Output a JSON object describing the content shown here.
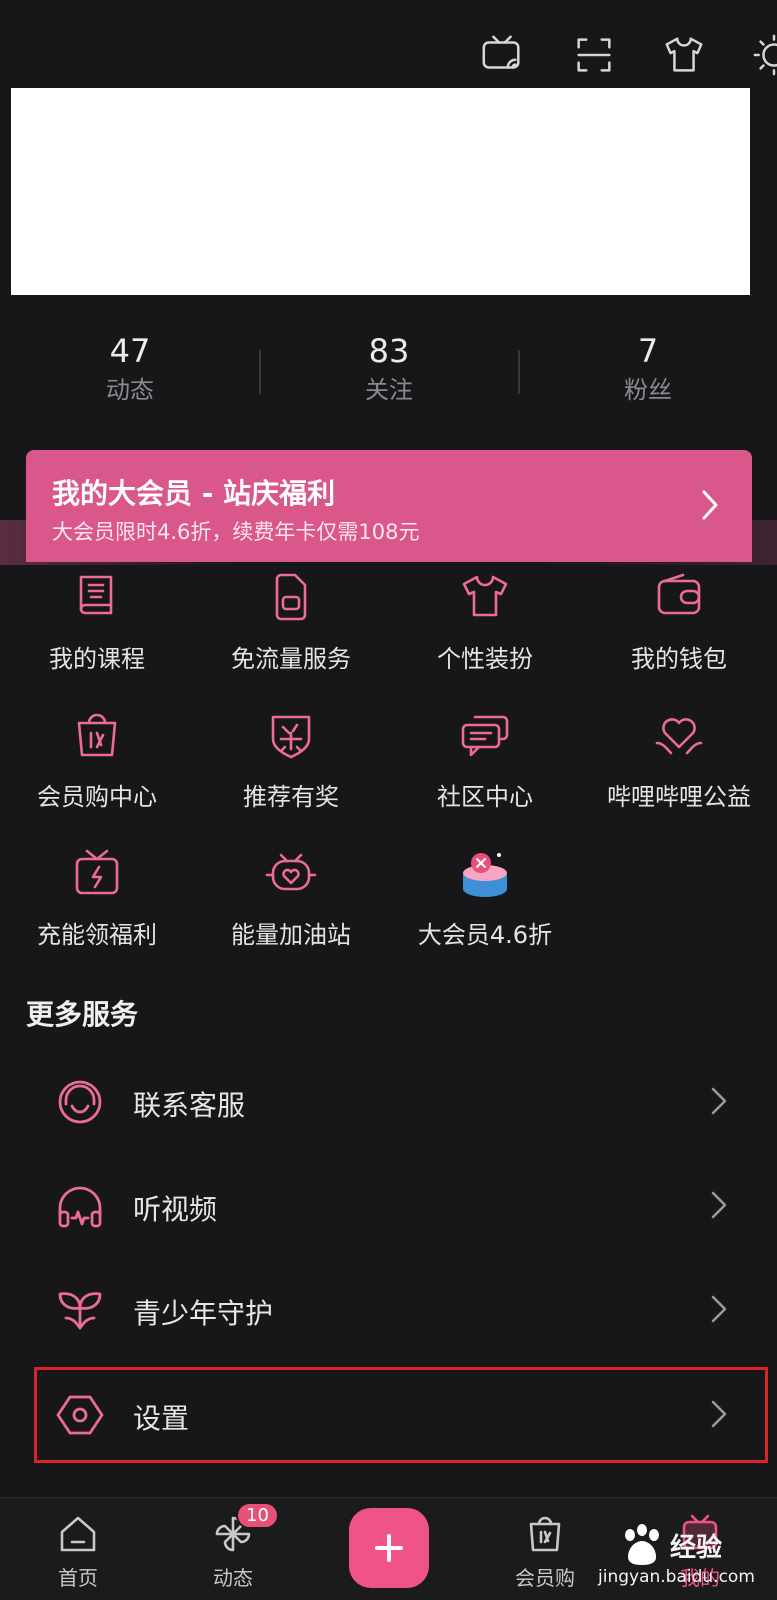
{
  "topbar": {
    "icons": [
      "tv-cast-icon",
      "scan-icon",
      "tshirt-icon",
      "brightness-icon"
    ]
  },
  "stats": [
    {
      "value": "47",
      "label": "动态"
    },
    {
      "value": "83",
      "label": "关注"
    },
    {
      "value": "7",
      "label": "粉丝"
    }
  ],
  "banner": {
    "title": "我的大会员 - 站庆福利",
    "subtitle": "大会员限时4.6折，续费年卡仅需108元"
  },
  "grid": [
    {
      "label": "我的课程",
      "icon": "course-icon"
    },
    {
      "label": "免流量服务",
      "icon": "sim-card-icon"
    },
    {
      "label": "个性装扮",
      "icon": "tshirt-icon"
    },
    {
      "label": "我的钱包",
      "icon": "wallet-icon"
    },
    {
      "label": "会员购中心",
      "icon": "shopping-bag-icon"
    },
    {
      "label": "推荐有奖",
      "icon": "reward-badge-icon"
    },
    {
      "label": "社区中心",
      "icon": "chat-bubbles-icon"
    },
    {
      "label": "哔哩哔哩公益",
      "icon": "heart-hands-icon"
    },
    {
      "label": "充能领福利",
      "icon": "gift-box-icon"
    },
    {
      "label": "能量加油站",
      "icon": "heart-tv-icon"
    },
    {
      "label": "大会员4.6折",
      "icon": "cake-icon"
    }
  ],
  "more_services": {
    "title": "更多服务",
    "items": [
      {
        "label": "联系客服",
        "icon": "headset-icon"
      },
      {
        "label": "听视频",
        "icon": "headphones-icon"
      },
      {
        "label": "青少年守护",
        "icon": "sprout-icon"
      },
      {
        "label": "设置",
        "icon": "settings-hexagon-icon"
      }
    ]
  },
  "tabbar": {
    "tabs": [
      {
        "label": "首页",
        "icon": "home-icon"
      },
      {
        "label": "动态",
        "icon": "pinwheel-icon",
        "badge": "10"
      },
      {
        "label": "会员购",
        "icon": "shopping-bag-icon"
      },
      {
        "label": "我的",
        "icon": "tv-icon"
      }
    ]
  },
  "watermark": {
    "brand": "经验",
    "url": "jingyan.baidu.com"
  },
  "colors": {
    "accent": "#ec6c95",
    "banner": "#d9578a",
    "background": "#17171a",
    "highlight_border": "#d9242b"
  }
}
